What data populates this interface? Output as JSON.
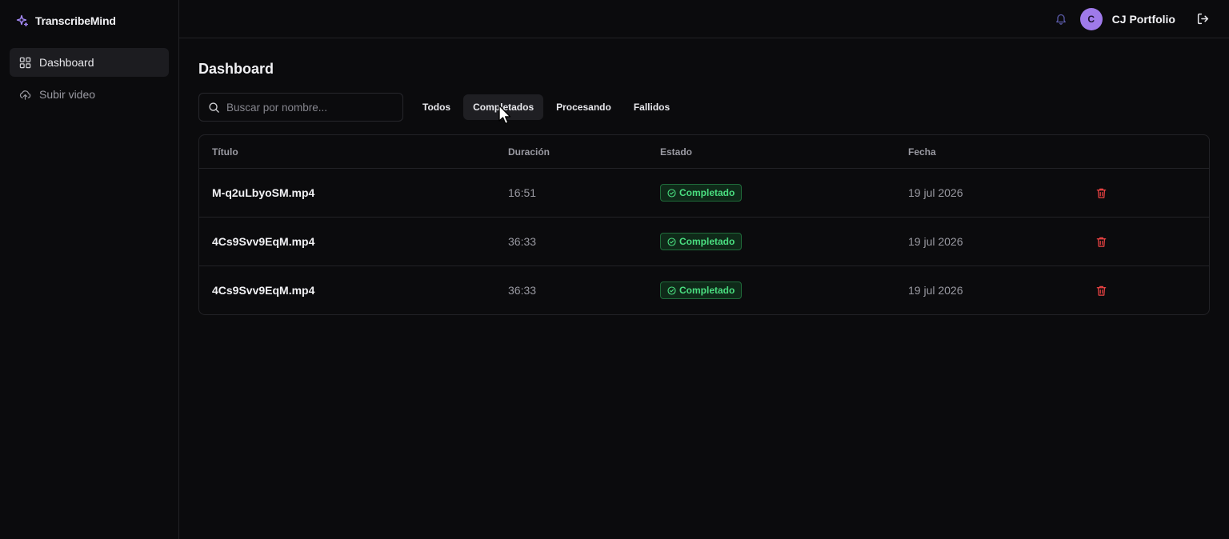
{
  "app": {
    "name": "TranscribeMind"
  },
  "sidebar": {
    "items": [
      {
        "label": "Dashboard",
        "icon": "grid-icon",
        "active": true
      },
      {
        "label": "Subir video",
        "icon": "upload-cloud-icon",
        "active": false
      }
    ]
  },
  "header": {
    "user": {
      "initial": "C",
      "name": "CJ Portfolio"
    }
  },
  "page": {
    "title": "Dashboard"
  },
  "search": {
    "placeholder": "Buscar por nombre...",
    "value": ""
  },
  "filters": [
    {
      "label": "Todos",
      "active": false
    },
    {
      "label": "Completados",
      "active": true
    },
    {
      "label": "Procesando",
      "active": false
    },
    {
      "label": "Fallidos",
      "active": false
    }
  ],
  "table": {
    "columns": [
      "Título",
      "Duración",
      "Estado",
      "Fecha"
    ],
    "rows": [
      {
        "title": "M-q2uLbyoSM.mp4",
        "duration": "16:51",
        "status": "Completado",
        "date": "19 jul 2026"
      },
      {
        "title": "4Cs9Svv9EqM.mp4",
        "duration": "36:33",
        "status": "Completado",
        "date": "19 jul 2026"
      },
      {
        "title": "4Cs9Svv9EqM.mp4",
        "duration": "36:33",
        "status": "Completado",
        "date": "19 jul 2026"
      }
    ]
  },
  "colors": {
    "accent": "#9f7aea",
    "success": "#4ade80",
    "danger": "#ef4444",
    "background": "#0b0b0d"
  }
}
